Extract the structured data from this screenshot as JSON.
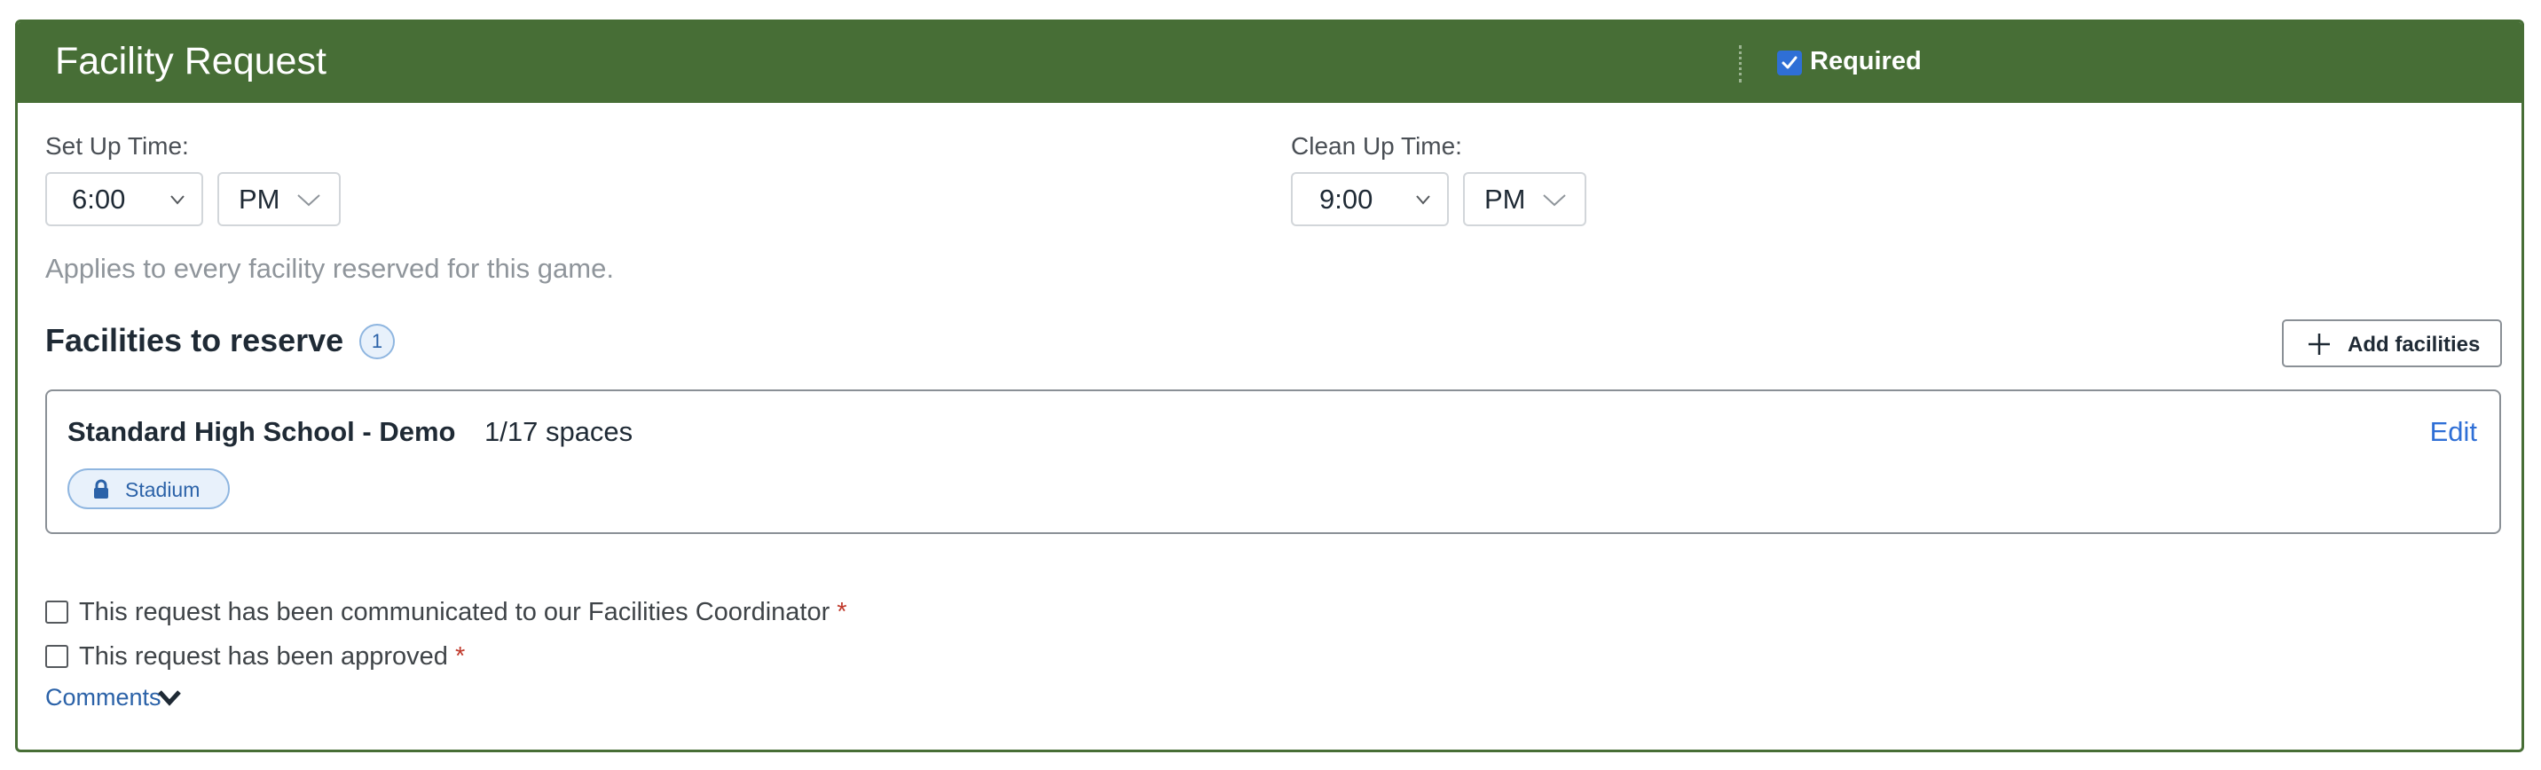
{
  "header": {
    "title": "Facility Request",
    "required_label": "Required",
    "required_checked": true
  },
  "setup": {
    "label": "Set Up Time:",
    "time": "6:00",
    "ampm": "PM"
  },
  "cleanup": {
    "label": "Clean Up Time:",
    "time": "9:00",
    "ampm": "PM"
  },
  "hint": "Applies to every facility reserved for this game.",
  "facilities": {
    "title": "Facilities to reserve",
    "count": "1",
    "add_label": "Add facilities",
    "items": [
      {
        "name": "Standard High School - Demo",
        "spaces": "1/17 spaces",
        "edit_label": "Edit",
        "tag": "Stadium"
      }
    ]
  },
  "checkboxes": [
    {
      "label": "This request has been communicated to our Facilities Coordinator",
      "required_mark": "*",
      "checked": false
    },
    {
      "label": "This request has been approved",
      "required_mark": "*",
      "checked": false
    }
  ],
  "comments": {
    "label": "Comments"
  },
  "colors": {
    "header_bg": "#476e36",
    "accent_blue": "#2f6fd6",
    "required_star": "#c0392b"
  },
  "icons": [
    "checkmark-icon",
    "chevron-down-icon",
    "plus-icon",
    "lock-icon"
  ]
}
